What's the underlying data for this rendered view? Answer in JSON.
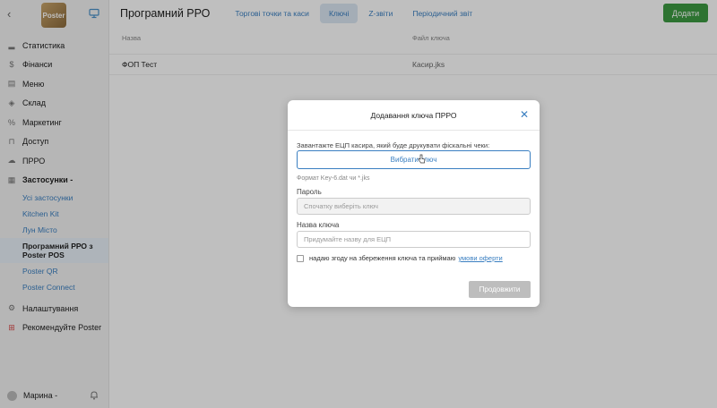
{
  "sidebar": {
    "logo_text": "Poster",
    "items": [
      {
        "label": "Статистика",
        "icon": "chart-icon"
      },
      {
        "label": "Фінанси",
        "icon": "dollar-icon"
      },
      {
        "label": "Меню",
        "icon": "document-icon"
      },
      {
        "label": "Склад",
        "icon": "layers-icon"
      },
      {
        "label": "Маркетинг",
        "icon": "percent-icon"
      },
      {
        "label": "Доступ",
        "icon": "lock-icon"
      },
      {
        "label": "ПРРО",
        "icon": "cloud-icon"
      },
      {
        "label": "Застосунки -",
        "icon": "apps-icon"
      }
    ],
    "subitems": [
      {
        "label": "Усі застосунки"
      },
      {
        "label": "Kitchen Kit"
      },
      {
        "label": "Лун Місто"
      },
      {
        "label": "Програмний РРО з Poster POS"
      },
      {
        "label": "Poster QR"
      },
      {
        "label": "Poster Connect"
      }
    ],
    "bottom_items": [
      {
        "label": "Налаштування",
        "icon": "gear-icon"
      },
      {
        "label": "Рекомендуйте Poster",
        "icon": "gift-icon"
      }
    ],
    "user_name": "Марина -"
  },
  "header": {
    "title": "Програмний РРО",
    "tabs": [
      {
        "label": "Торгові точки та каси"
      },
      {
        "label": "Ключі"
      },
      {
        "label": "Z-звіти"
      },
      {
        "label": "Періодичний звіт"
      }
    ],
    "add_label": "Додати"
  },
  "table": {
    "columns": [
      "Назва",
      "Файл ключа"
    ],
    "rows": [
      [
        "ФОП Тест",
        "Касир.jks"
      ]
    ]
  },
  "modal": {
    "title": "Додавання ключа ПРРО",
    "upload_label": "Завантажте ЕЦП касира, який буде друкувати фіскальні чеки:",
    "choose_key_label": "Вибрати ключ",
    "format_hint": "Формат Key-6.dat чи *.jks",
    "password_label": "Пароль",
    "password_placeholder": "Спочатку виберіть ключ",
    "keyname_label": "Назва ключа",
    "keyname_placeholder": "Придумайте назву для ЕЦП",
    "consent_text": "надаю згоду на збереження ключа та приймаю",
    "offer_link": "умови оферти",
    "continue_label": "Продовжити"
  },
  "colors": {
    "accent": "#3a7fc1",
    "primary_green": "#3c9a42",
    "disabled": "#bdbdbd"
  }
}
